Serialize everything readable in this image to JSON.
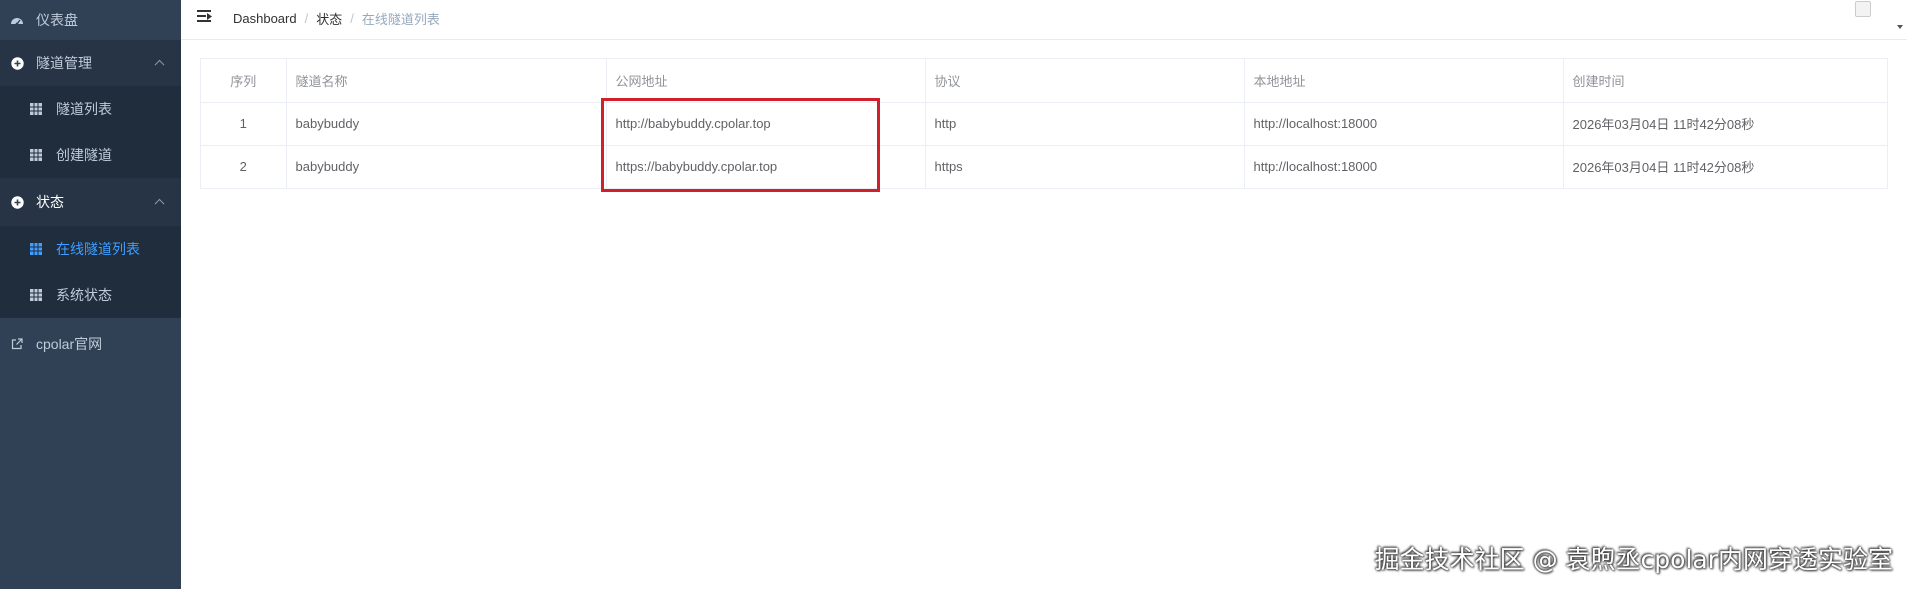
{
  "sidebar": {
    "dashboard_label": "仪表盘",
    "tunnel_mgmt_label": "隧道管理",
    "tunnel_list_label": "隧道列表",
    "create_tunnel_label": "创建隧道",
    "status_label": "状态",
    "online_tunnels_label": "在线隧道列表",
    "system_status_label": "系统状态",
    "website_label": "cpolar官网"
  },
  "header": {
    "breadcrumb": [
      "Dashboard",
      "状态",
      "在线隧道列表"
    ]
  },
  "table": {
    "headers": [
      "序列",
      "隧道名称",
      "公网地址",
      "协议",
      "本地地址",
      "创建时间"
    ],
    "rows": [
      {
        "index": "1",
        "name": "babybuddy",
        "public_url": "http://babybuddy.cpolar.top",
        "protocol": "http",
        "local_addr": "http://localhost:18000",
        "created": "2026年03月04日 11时42分08秒"
      },
      {
        "index": "2",
        "name": "babybuddy",
        "public_url": "https://babybuddy.cpolar.top",
        "protocol": "https",
        "local_addr": "http://localhost:18000",
        "created": "2026年03月04日 11时42分08秒"
      }
    ]
  },
  "watermark": "掘金技术社区 @ 袁煦丞cpolar内网穿透实验室",
  "colors": {
    "sidebar_bg": "#304156",
    "sidebar_sub_bg": "#1f2d3d",
    "active": "#409eff",
    "highlight_box": "#d0202a"
  },
  "icons": {
    "dashboard": "dashboard-icon",
    "group": "plus-circle-icon",
    "item": "grid-table-icon",
    "external": "external-link-icon"
  }
}
